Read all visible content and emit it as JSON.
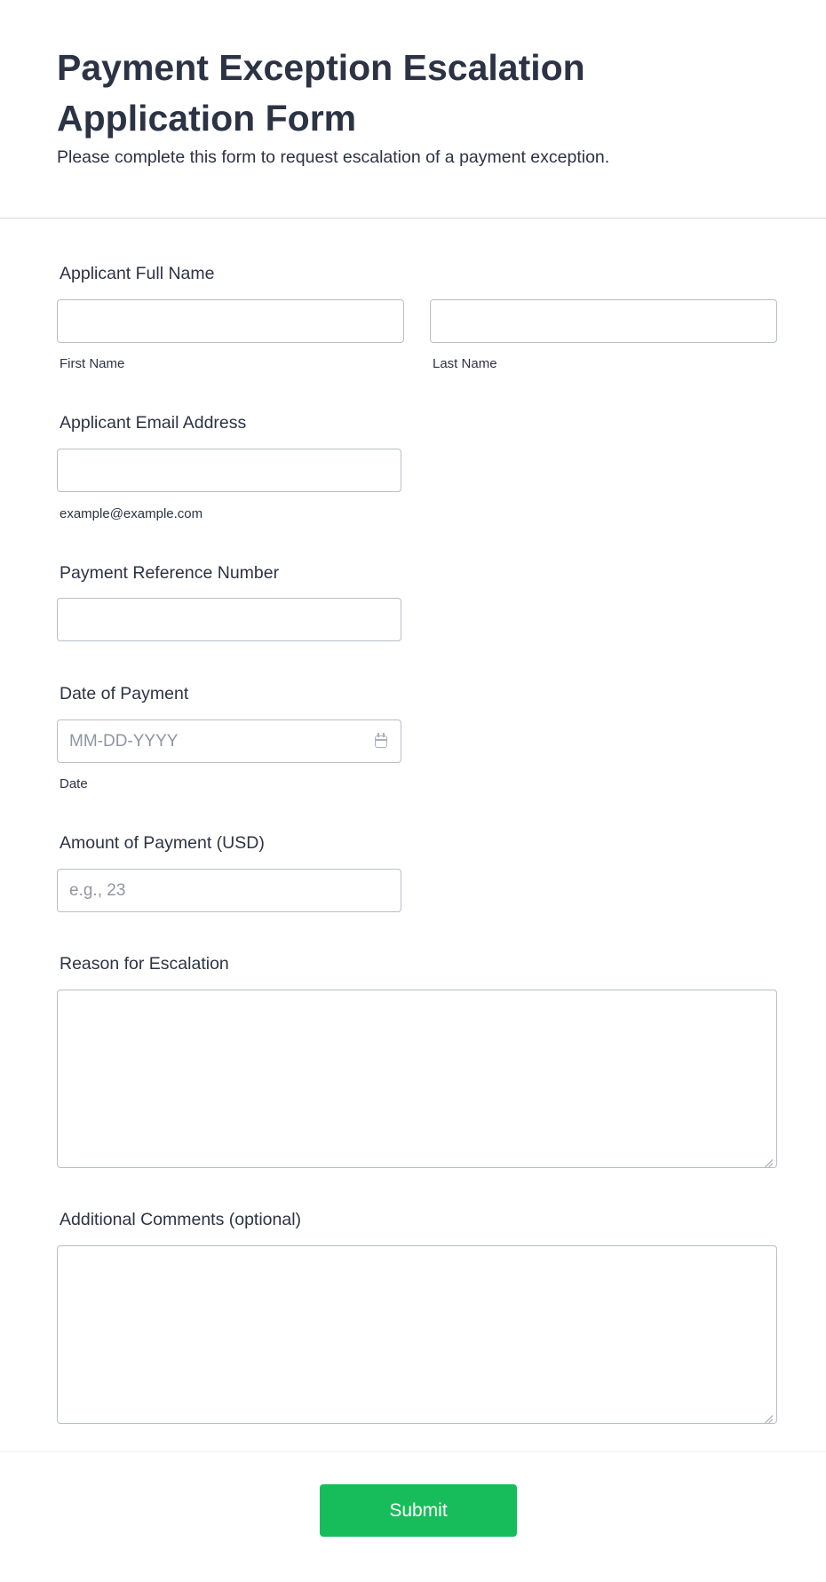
{
  "header": {
    "title": "Payment Exception Escalation Application Form",
    "subtitle": "Please complete this form to request escalation of a payment exception."
  },
  "fields": {
    "full_name": {
      "label": "Applicant Full Name",
      "first_sublabel": "First Name",
      "last_sublabel": "Last Name",
      "first_value": "",
      "last_value": ""
    },
    "email": {
      "label": "Applicant Email Address",
      "sublabel": "example@example.com",
      "value": ""
    },
    "reference": {
      "label": "Payment Reference Number",
      "value": ""
    },
    "date": {
      "label": "Date of Payment",
      "placeholder": "MM-DD-YYYY",
      "sublabel": "Date",
      "icon": "calendar-icon"
    },
    "amount": {
      "label": "Amount of Payment (USD)",
      "placeholder": "e.g., 23"
    },
    "reason": {
      "label": "Reason for Escalation",
      "value": ""
    },
    "comments": {
      "label": "Additional Comments (optional)",
      "value": ""
    }
  },
  "submit": {
    "label": "Submit"
  },
  "colors": {
    "accent": "#18bd5b",
    "text": "#2c3345",
    "border": "#b8bdc9",
    "placeholder": "#8f96a3"
  }
}
